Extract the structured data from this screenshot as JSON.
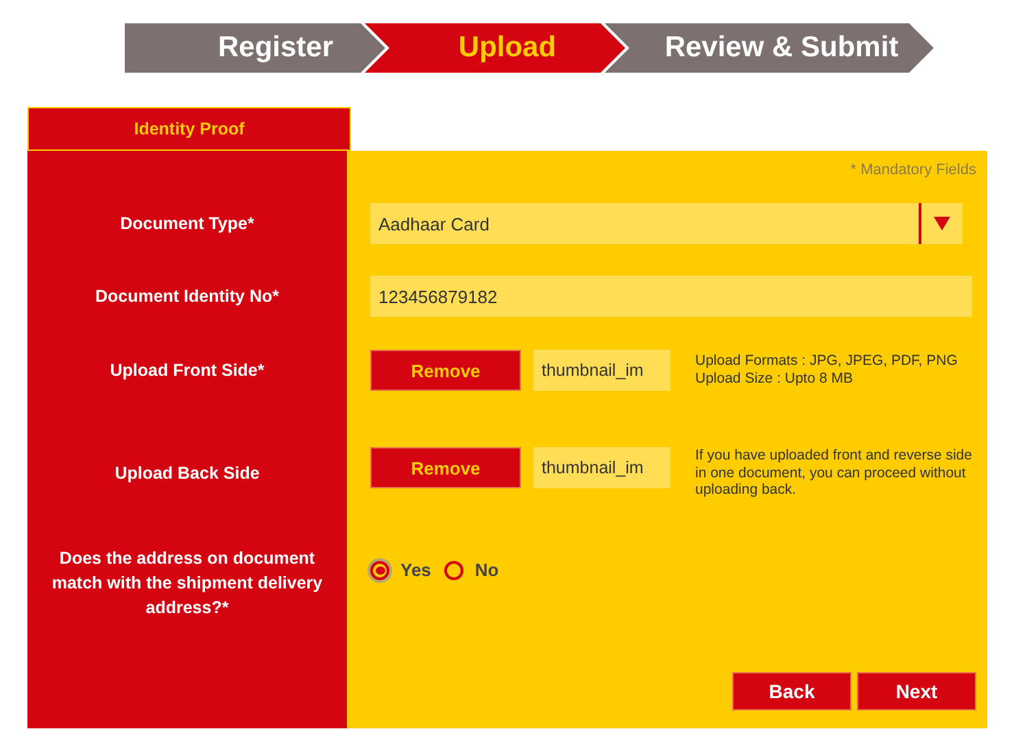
{
  "steps": [
    {
      "label": "Register",
      "selected": false
    },
    {
      "label": "Upload",
      "selected": true
    },
    {
      "label": "Review & Submit",
      "selected": false
    }
  ],
  "section_tab": {
    "label": "Identity Proof"
  },
  "mandatory_note": "* Mandatory Fields",
  "fields": [
    {
      "kind": "select",
      "label": "Document Type*",
      "value": "Aadhaar Card"
    },
    {
      "kind": "text",
      "label": "Document Identity No*",
      "value": "123456879182"
    },
    {
      "kind": "upload",
      "label": "Upload Front Side*",
      "button": "Remove",
      "file": "thumbnail_im",
      "hint": "Upload Formats : JPG, JPEG, PDF, PNG Upload Size : Upto 8 MB"
    },
    {
      "kind": "upload",
      "label": "Upload Back Side",
      "button": "Remove",
      "file": "thumbnail_im",
      "hint": "If you have uploaded front and reverse side in one document, you can proceed without uploading back."
    },
    {
      "kind": "radio",
      "label": "Does the address on document match with the shipment delivery address?*",
      "options": [
        {
          "label": "Yes",
          "selected": true
        },
        {
          "label": "No",
          "selected": false
        }
      ]
    }
  ],
  "buttons": [
    "Back",
    "Next"
  ]
}
